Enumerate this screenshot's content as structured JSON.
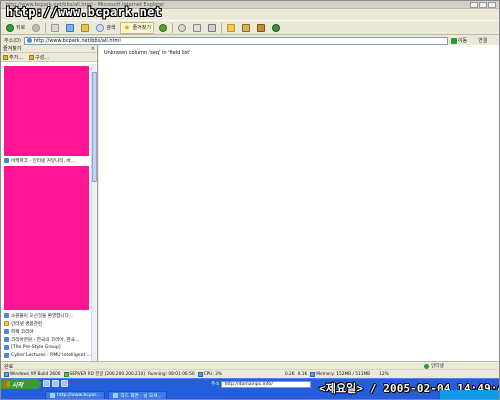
{
  "window": {
    "title": "http://www.bcpark.net/bbs/all.html - Microsoft Internet Explorer",
    "watermark": "http://www.bcpark.net"
  },
  "toolbar": {
    "back_label": "뒤로",
    "search_label": "검색",
    "favorites_label": "즐겨찾기"
  },
  "address": {
    "label": "주소(D)",
    "value": "http://www.bcpark.net/bbs/all.html",
    "go_label": "이동",
    "links_label": "연결"
  },
  "sidebar": {
    "title": "즐겨찾기",
    "close": "×",
    "add_label": "추가...",
    "organize_label": "구성...",
    "items": [
      {
        "label": "바케파크 - 인터넷 커뮤니티, 바..."
      },
      {
        "label": "소원풀이 오신것을 환영합니다..."
      },
      {
        "label": "인터넷 경품관련"
      },
      {
        "label": "퍼펙 코리아"
      },
      {
        "label": "코리아천원 - 한국의 코리아, 한국..."
      },
      {
        "label": "[The Pre-Style Group]"
      },
      {
        "label": "Cyber Lectures - RMU Intelligent ..."
      }
    ]
  },
  "content": {
    "message": "Unknown column 'seq' in 'field list'"
  },
  "status": {
    "left": "완료",
    "right": "인터넷"
  },
  "perf": [
    "Windows XP Build 2600",
    "SERVER RD 한글 [200.200.200.210]",
    "Running: 08:01:06:50",
    "CPU: 3%",
    "0.2K",
    "0.1K",
    "Memory: 152MB / 511MB",
    "12%"
  ],
  "taskbar": {
    "start_label": "시작",
    "address_label": "주소",
    "address_value": "http://domainpc.info/",
    "clock_overlay": "<제요일> / 2005-02-04 14:49:42",
    "tasks": [
      {
        "label": "http://www.bcpar..."
      },
      {
        "label": "리드 화면 - 님 모셔..."
      }
    ]
  },
  "colors": {
    "pink_block": "#ff1493",
    "taskbar": "#245edb",
    "start_button": "#3c9a3c"
  }
}
